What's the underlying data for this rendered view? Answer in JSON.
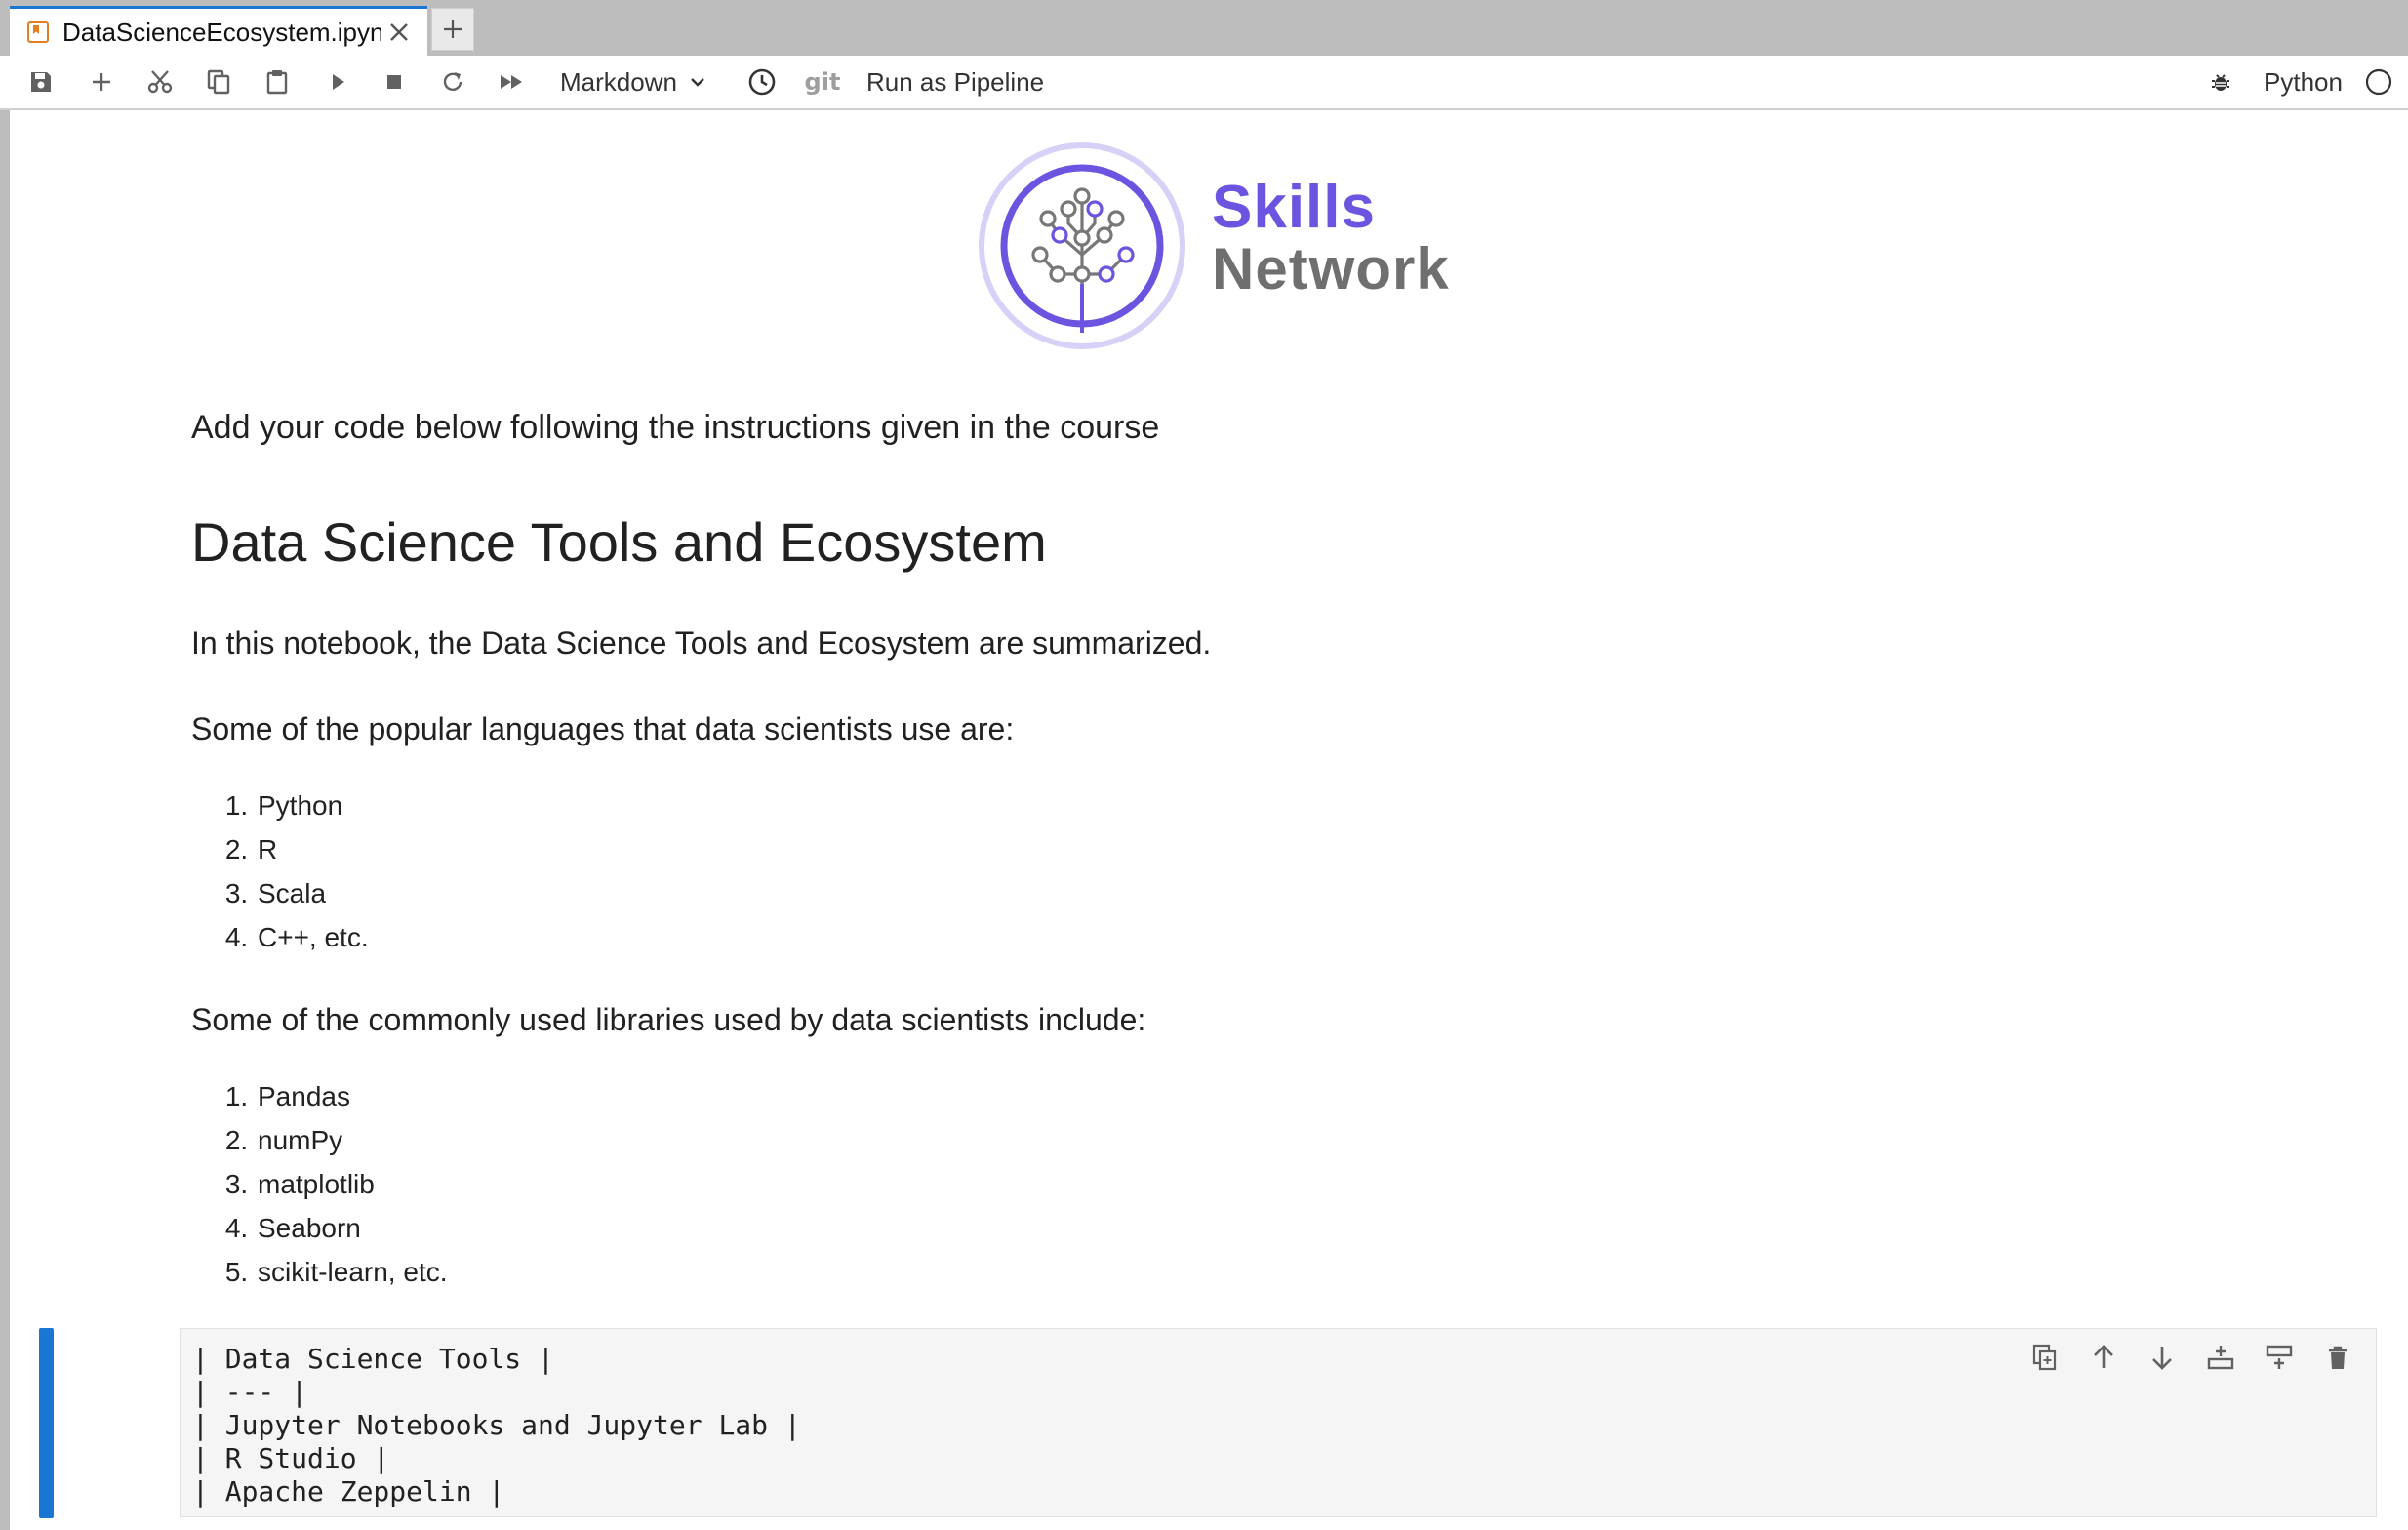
{
  "tab": {
    "title": "DataScienceEcosystem.ipyn"
  },
  "toolbar": {
    "cell_type": "Markdown",
    "git": "git",
    "run_pipeline": "Run as Pipeline",
    "kernel": "Python"
  },
  "logo": {
    "line1": "Skills",
    "line2": "Network"
  },
  "notebook": {
    "intro": "Add your code below following the instructions given in the course",
    "heading": "Data Science Tools and Ecosystem",
    "summary": "In this notebook, the Data Science Tools and Ecosystem are summarized.",
    "languages_intro": "Some of the popular languages that data scientists use are:",
    "languages": [
      "Python",
      "R",
      "Scala",
      "C++, etc."
    ],
    "libraries_intro": "Some of the commonly used libraries used by data scientists include:",
    "libraries": [
      "Pandas",
      "numPy",
      "matplotlib",
      "Seaborn",
      "scikit-learn, etc."
    ]
  },
  "active_cell": {
    "lines": [
      "| Data Science Tools |",
      "| --- |",
      "| Jupyter Notebooks and Jupyter Lab |",
      "| R Studio |",
      "| Apache Zeppelin |"
    ]
  },
  "colors": {
    "accent": "#1976d2",
    "brand_purple": "#6c53e0",
    "brand_gray": "#6f6f6f"
  }
}
